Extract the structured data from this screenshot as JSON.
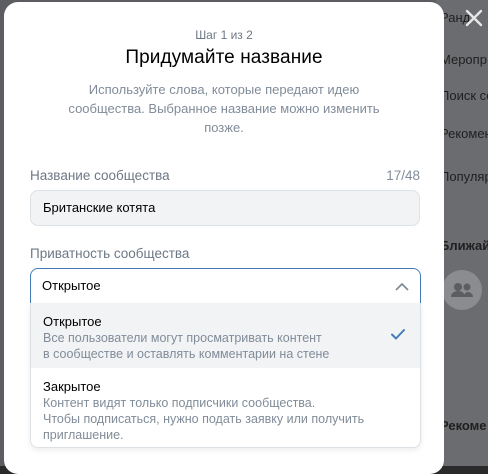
{
  "background": {
    "items": [
      "Ранд",
      "Меропр",
      "Поиск со",
      "Рекомен",
      "Популяр"
    ],
    "section_titles": [
      "Ближай",
      "Рекоме"
    ]
  },
  "modal": {
    "step": "Шаг 1 из 2",
    "title": "Придумайте название",
    "subtitle": "Используйте слова, которые передают идею сообщества. Выбранное название можно изменить позже.",
    "name_field": {
      "label": "Название сообщества",
      "counter": "17/48",
      "value": "Британские котята"
    },
    "privacy_field": {
      "label": "Приватность сообщества",
      "selected": "Открытое",
      "options": [
        {
          "title": "Открытое",
          "description_lines": [
            "Все пользователи могут просматривать контент",
            "в сообществе и оставлять комментарии на стене"
          ],
          "selected": true
        },
        {
          "title": "Закрытое",
          "description_lines": [
            "Контент видят только подписчики сообщества.",
            "Чтобы подписаться, нужно подать заявку или получить",
            "приглашение."
          ],
          "selected": false
        }
      ]
    }
  },
  "colors": {
    "accent": "#447bba",
    "muted_text": "#818c99",
    "input_bg": "#f2f3f5"
  }
}
